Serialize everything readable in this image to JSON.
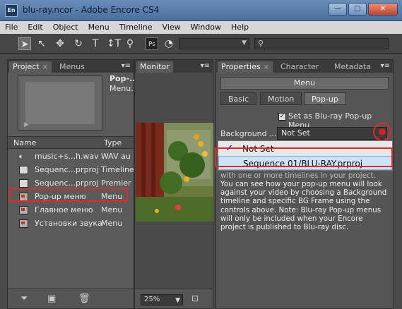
{
  "window": {
    "app_icon": "En",
    "title": "blu-ray.ncor - Adobe Encore CS4",
    "controls": {
      "minimize": "—",
      "maximize": "□",
      "close": "✕"
    }
  },
  "menubar": [
    "File",
    "Edit",
    "Object",
    "Menu",
    "Timeline",
    "View",
    "Window",
    "Help"
  ],
  "toolbar": {
    "icons": [
      "selection-tool",
      "direct-select-tool",
      "move-tool",
      "rotate-tool",
      "text-tool",
      "vertical-text-tool",
      "zoom-tool",
      "photoshop-button",
      "preview-button"
    ],
    "text_tool": "T",
    "vtext_tool": "↕T",
    "ps_label": "Ps"
  },
  "project_panel": {
    "tabs": [
      "Project",
      "Menus"
    ],
    "preview_name": "Pop-...",
    "preview_type": "Menu...",
    "columns": {
      "name": "Name",
      "type": "Type"
    },
    "items": [
      {
        "name": "music+s...h.wav",
        "type": "WAV au",
        "icon": "audio-icon"
      },
      {
        "name": "Sequenc...prproj",
        "type": "Timeline",
        "icon": "sequence-icon"
      },
      {
        "name": "Sequenc...prproj",
        "type": "Premier",
        "icon": "sequence-icon"
      },
      {
        "name": "Pop-up меню",
        "type": "Menu",
        "icon": "menu-icon"
      },
      {
        "name": "Главное меню",
        "type": "Menu",
        "icon": "menu-icon"
      },
      {
        "name": "Установки звука",
        "type": "Menu",
        "icon": "menu-icon"
      }
    ]
  },
  "monitor_panel": {
    "tab": "Monitor",
    "zoom": "25%"
  },
  "properties_panel": {
    "tabs": [
      "Properties",
      "Character",
      "Metadata"
    ],
    "object_type": "Menu",
    "subtabs": [
      "Basic",
      "Motion",
      "Pop-up"
    ],
    "active_subtab": "Pop-up",
    "checkbox_label": "Set as Blu-ray Pop-up Menu",
    "checkbox_checked": true,
    "background_label": "Background ...",
    "background_value": "Not Set",
    "dropdown_options": [
      {
        "label": "Not Set",
        "checked": true
      },
      {
        "label": "Sequence 01/BLU-RAY.prproj",
        "checked": false
      }
    ],
    "note_fragment": "with one or more timelines in your project.",
    "note": "You can see how your pop-up menu will look against your video by choosing a Background timeline and specific BG Frame using the controls above. Note: Blu-ray Pop-up menus will only be included when your Encore project is published to Blu-ray disc."
  },
  "colors": {
    "highlight": "#e0282a",
    "panel_bg": "#555555",
    "titlebar": "#5a7cab"
  }
}
